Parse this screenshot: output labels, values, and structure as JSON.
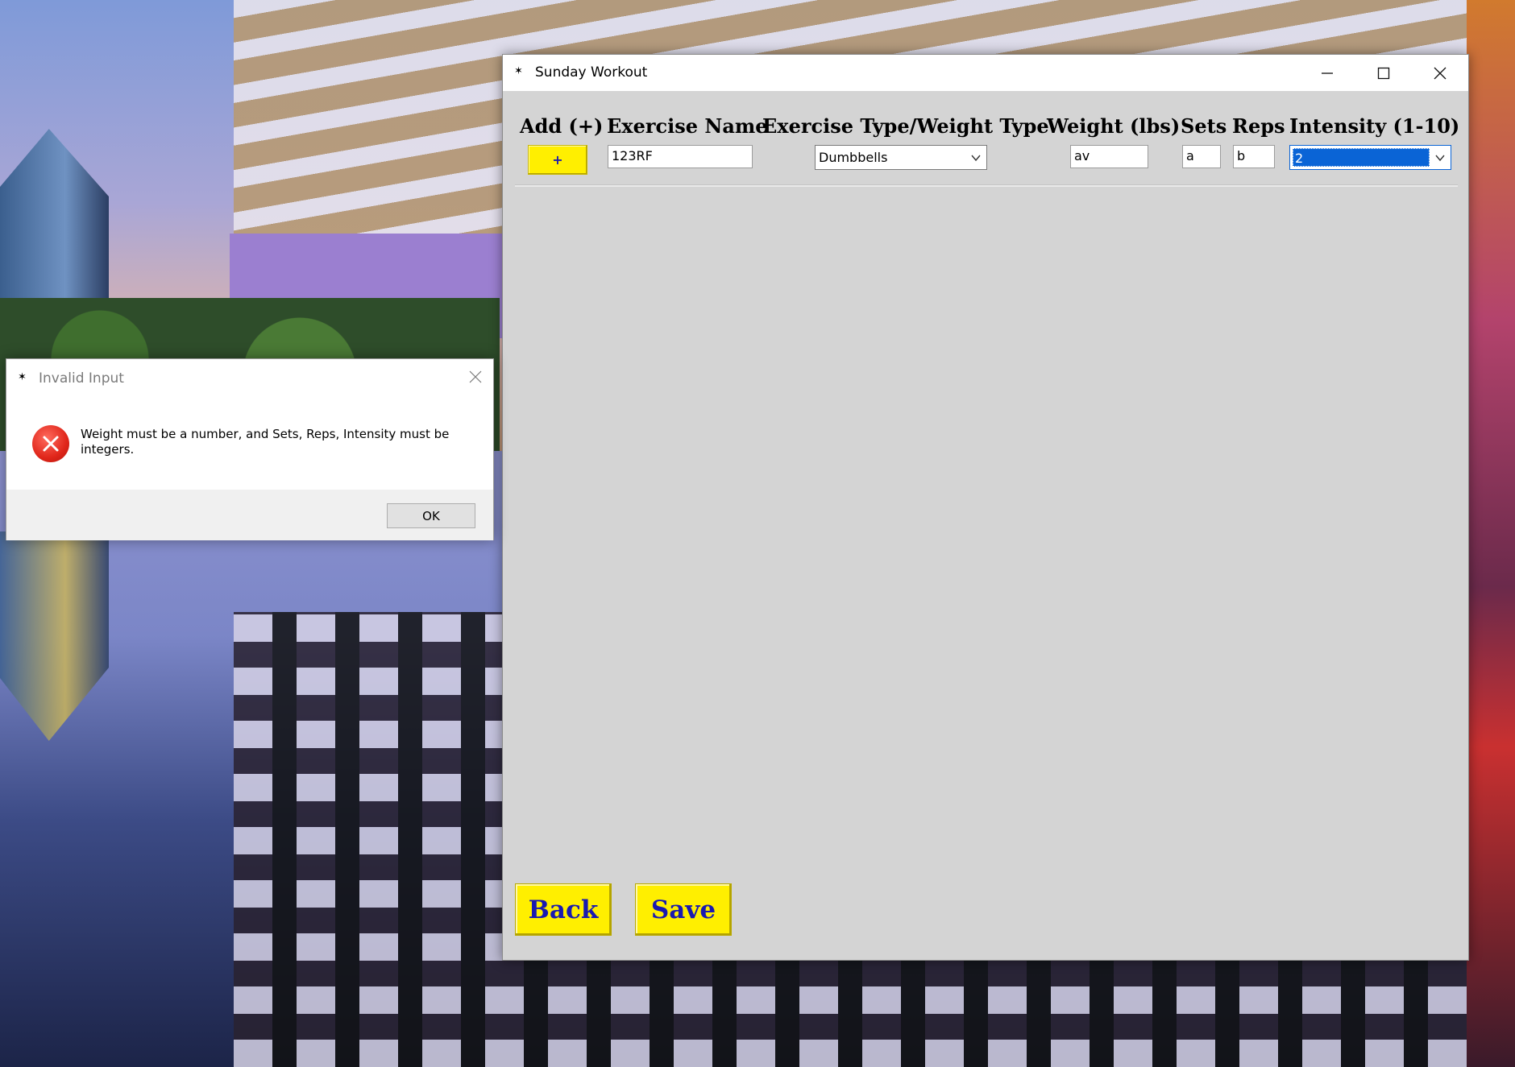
{
  "window": {
    "title": "Sunday Workout",
    "minimize_icon": "minimize-icon",
    "maximize_icon": "maximize-icon",
    "close_icon": "close-icon"
  },
  "headers": {
    "add": "Add (+)",
    "exercise_name": "Exercise Name",
    "exercise_type": "Exercise Type/Weight Type",
    "weight": "Weight (lbs)",
    "sets": "Sets",
    "reps": "Reps",
    "intensity": "Intensity (1-10)"
  },
  "row": {
    "add_label": "+",
    "exercise_name": "123RF",
    "exercise_type": "Dumbbells",
    "weight": "av",
    "sets": "a",
    "reps": "b",
    "intensity": "2"
  },
  "footer": {
    "back_label": "Back",
    "save_label": "Save"
  },
  "colors": {
    "button_yellow": "#ffef00",
    "button_text_blue": "#1a1ab0",
    "window_bg": "#d4d4d4",
    "selection_blue": "#0a64d6"
  },
  "dialog": {
    "title": "Invalid Input",
    "icon": "error-icon",
    "message": "Weight must be a number, and Sets, Reps, Intensity must be integers.",
    "ok_label": "OK"
  }
}
